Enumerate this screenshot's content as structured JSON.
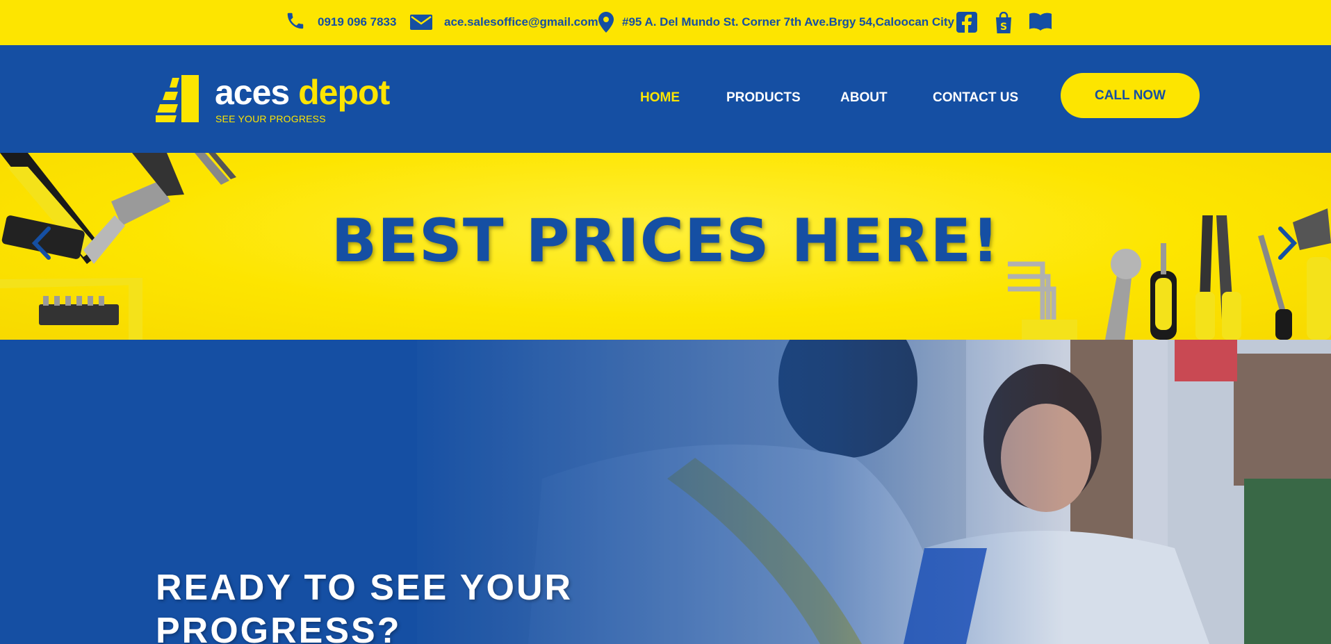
{
  "topbar": {
    "phone": "0919 096 7833",
    "email": "ace.salesoffice@gmail.com",
    "address": "#95 A. Del Mundo St. Corner 7th Ave.Brgy 54,Caloocan City",
    "icons": [
      "phone-icon",
      "mail-icon",
      "location-pin-icon",
      "facebook-icon",
      "shop-bag-icon",
      "book-icon"
    ]
  },
  "header": {
    "logo_word1": "aces",
    "logo_word2": "depot",
    "tagline": "SEE YOUR PROGRESS",
    "nav": [
      "HOME",
      "PRODUCTS",
      "ABOUT",
      "CONTACT US"
    ],
    "active_nav": "HOME",
    "cta": "CALL NOW"
  },
  "banner": {
    "title": "BEST PRICES HERE!"
  },
  "hero": {
    "title": "READY TO SEE YOUR PROGRESS?"
  },
  "colors": {
    "brand_blue": "#154fa3",
    "brand_yellow": "#fde500",
    "white": "#ffffff"
  }
}
